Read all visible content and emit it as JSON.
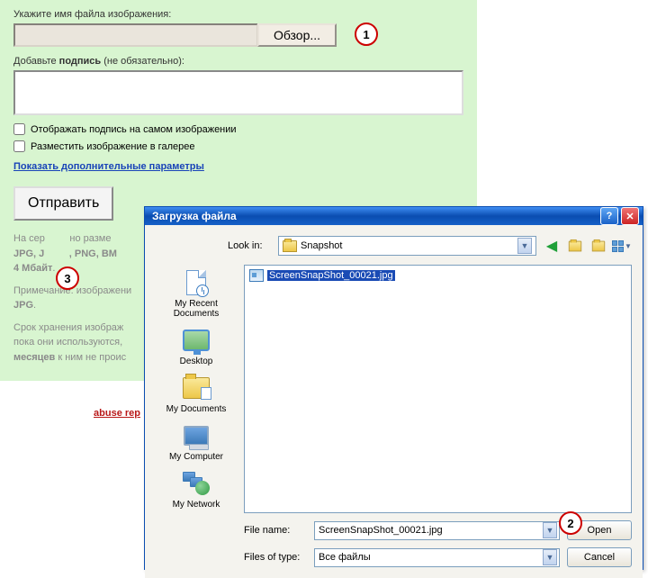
{
  "upload": {
    "file_label": "Укажите имя файла изображения:",
    "browse_btn": "Обзор...",
    "caption_label_prefix": "Добавьте ",
    "caption_label_bold": "подпись",
    "caption_label_suffix": " (не обязательно):",
    "checkbox_on_image": "Отображать подпись на самом изображении",
    "checkbox_gallery": "Разместить изображение в галерее",
    "params_link": "Показать дополнительные параметры",
    "submit": "Отправить",
    "formats_prefix": "На сер",
    "formats_mid": "но разме",
    "formats_bold": "JPG, J",
    "formats_bold2": ", PNG, BM",
    "size_bold": "4 Мбайт",
    "note2_prefix": "Примечание: изображени",
    "note2_bold": "JPG",
    "storage_prefix": "Срок хранения изображ",
    "storage_mid": "пока они используются,",
    "storage_bold": "месяцев",
    "storage_suffix": " к ним не проис",
    "abuse_link": "abuse rep"
  },
  "badges": {
    "b1": "1",
    "b2": "2",
    "b3": "3"
  },
  "dialog": {
    "title": "Загрузка файла",
    "lookin_label": "Look in:",
    "lookin_value": "Snapshot",
    "places": {
      "recent": "My Recent\nDocuments",
      "desktop": "Desktop",
      "mydocs": "My Documents",
      "mycomp": "My Computer",
      "network": "My Network"
    },
    "file_item": "ScreenSnapShot_00021.jpg",
    "filename_label": "File name:",
    "filename_value": "ScreenSnapShot_00021.jpg",
    "filetype_label": "Files of type:",
    "filetype_value": "Все файлы",
    "open": "Open",
    "cancel": "Cancel"
  }
}
